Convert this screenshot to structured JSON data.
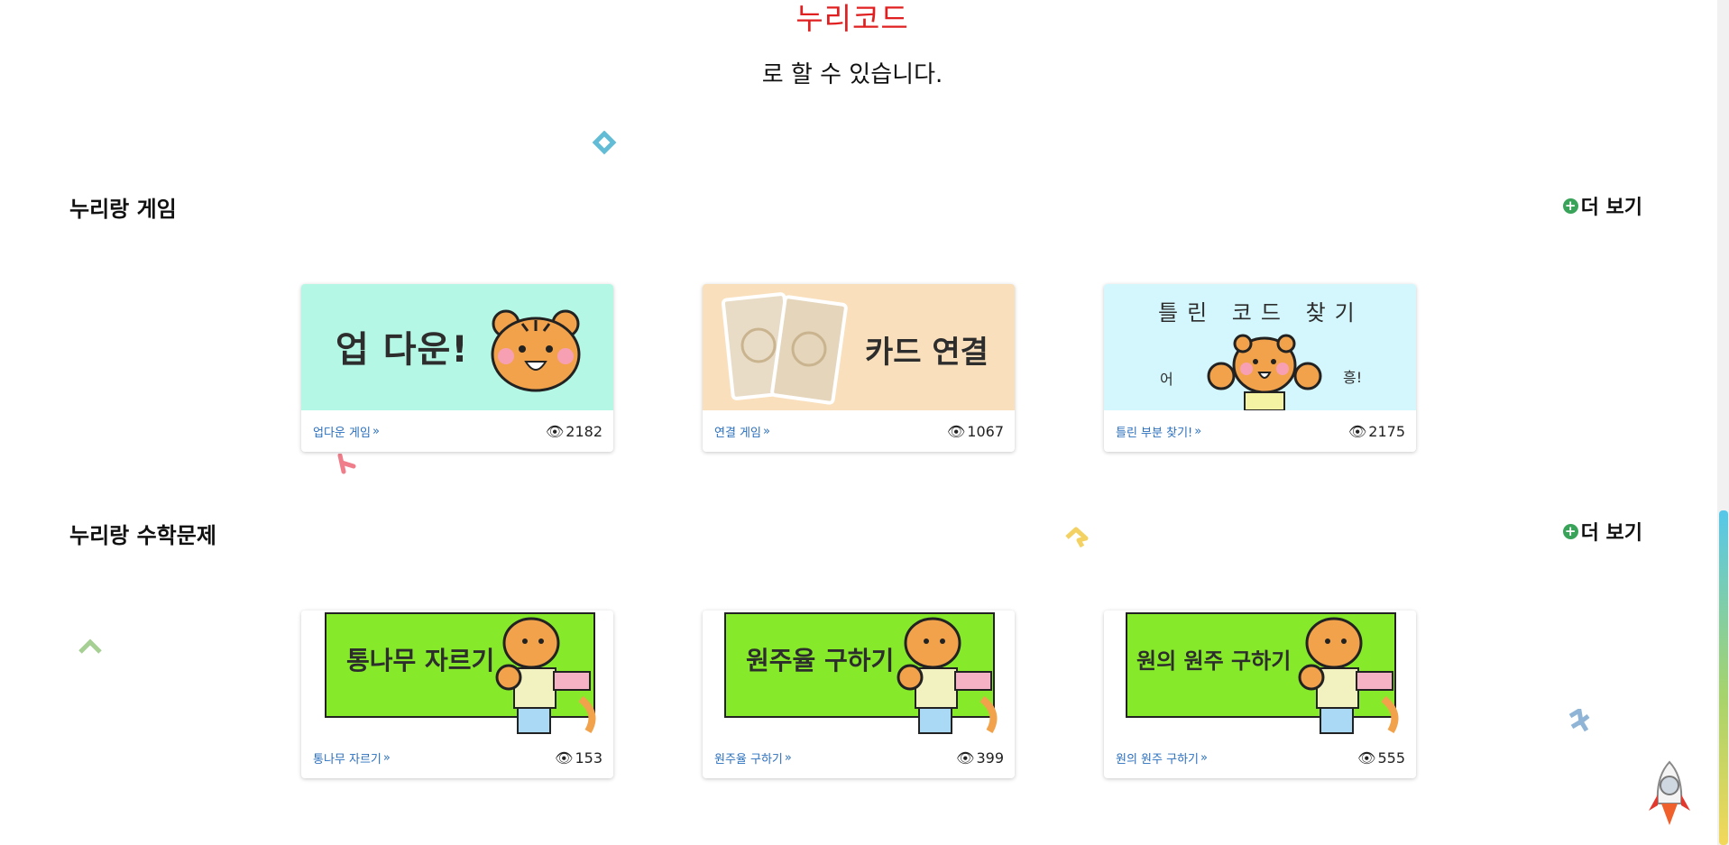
{
  "hero": {
    "brand": "누리코드",
    "tail": "로 할 수 있습니다."
  },
  "sections": [
    {
      "title": "누리랑 게임",
      "more_label": "더 보기",
      "cards": [
        {
          "label": "업다운 게임",
          "views": "2182",
          "thumb_text": "업 다운!"
        },
        {
          "label": "연결 게임",
          "views": "1067",
          "thumb_text": "카드 연결"
        },
        {
          "label": "틀린 부분 찾기!",
          "views": "2175",
          "thumb_text": "틀린 코드 찾기",
          "thumb_left": "어",
          "thumb_right": "흥!"
        }
      ]
    },
    {
      "title": "누리랑 수학문제",
      "more_label": "더 보기",
      "cards": [
        {
          "label": "통나무 자르기",
          "views": "153",
          "thumb_text": "통나무 자르기"
        },
        {
          "label": "원주율 구하기",
          "views": "399",
          "thumb_text": "원주율 구하기"
        },
        {
          "label": "원의 원주 구하기",
          "views": "555",
          "thumb_text": "원의 원주 구하기"
        }
      ]
    }
  ],
  "colors": {
    "brand": "#e02020",
    "link": "#2a6fbe",
    "plus": "#3aa35a",
    "thumb_updown": "#b4f7e4",
    "thumb_connect": "#f9dfbb",
    "thumb_find": "#d3f7fd",
    "thumb_math": "#86ea2a"
  },
  "icons": {
    "more": "plus-circle-icon",
    "views": "eye-icon",
    "link_arrow": "double-chevron-right-icon",
    "scroll_top": "rocket-icon"
  }
}
